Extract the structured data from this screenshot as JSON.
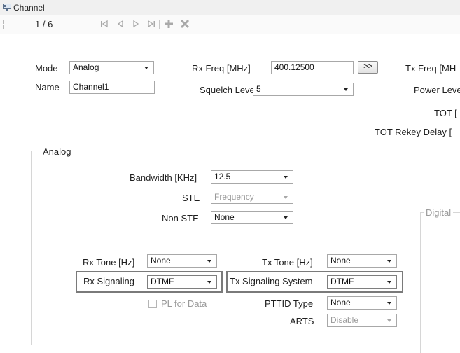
{
  "window": {
    "title": "Channel"
  },
  "toolbar": {
    "record_counter": "1 / 6"
  },
  "general": {
    "mode": {
      "label": "Mode",
      "value": "Analog"
    },
    "name": {
      "label": "Name",
      "value": "Channel1"
    },
    "rx_freq": {
      "label": "Rx Freq [MHz]",
      "value": "400.12500"
    },
    "copy_button": {
      "label": ">>"
    },
    "squelch": {
      "label": "Squelch Level",
      "value": "5"
    },
    "tx_freq": {
      "label": "Tx Freq [MH"
    },
    "power_level": {
      "label": "Power Leve"
    },
    "tot": {
      "label": "TOT ["
    },
    "tot_rekey": {
      "label": "TOT Rekey Delay ["
    }
  },
  "analog": {
    "group_title": "Analog",
    "bandwidth": {
      "label": "Bandwidth [KHz]",
      "value": "12.5"
    },
    "ste": {
      "label": "STE",
      "value": "Frequency"
    },
    "non_ste": {
      "label": "Non STE",
      "value": "None"
    },
    "rx_tone": {
      "label": "Rx Tone [Hz]",
      "value": "None"
    },
    "tx_tone": {
      "label": "Tx Tone [Hz]",
      "value": "None"
    },
    "rx_signaling": {
      "label": "Rx Signaling",
      "value": "DTMF"
    },
    "tx_signaling_system": {
      "label": "Tx Signaling System",
      "value": "DTMF"
    },
    "pl_for_data": {
      "label": "PL for Data"
    },
    "pttid_type": {
      "label": "PTTID Type",
      "value": "None"
    },
    "arts": {
      "label": "ARTS",
      "value": "Disable"
    }
  },
  "digital": {
    "group_title": "Digital"
  }
}
